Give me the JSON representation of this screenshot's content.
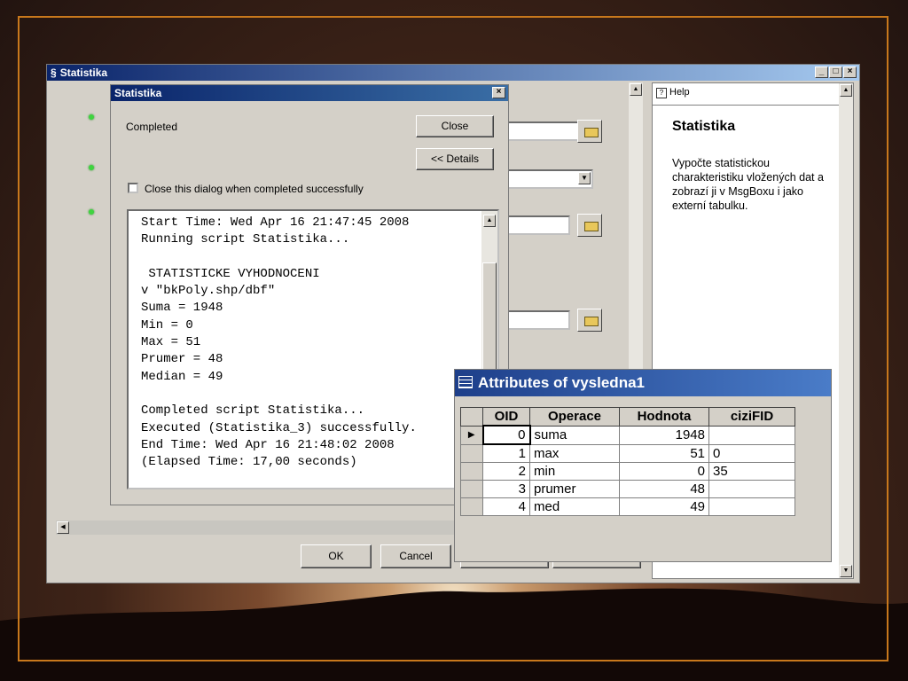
{
  "main_window": {
    "title": "Statistika"
  },
  "progress_dialog": {
    "title": "Statistika",
    "status": "Completed",
    "close_label": "Close",
    "details_label": "<< Details",
    "close_checkbox_label": "Close this dialog when completed successfully",
    "log": "Start Time: Wed Apr 16 21:47:45 2008\nRunning script Statistika...\n\n STATISTICKE VYHODNOCENI\nv \"bkPoly.shp/dbf\"\nSuma = 1948\nMin = 0\nMax = 51\nPrumer = 48\nMedian = 49\n\nCompleted script Statistika...\nExecuted (Statistika_3) successfully.\nEnd Time: Wed Apr 16 21:48:02 2008\n(Elapsed Time: 17,00 seconds)"
  },
  "buttons": {
    "ok": "OK",
    "cancel": "Cancel"
  },
  "help_panel": {
    "tab_label": "Help",
    "title": "Statistika",
    "text": "Vypočte statistickou charakteristiku vložených dat a zobrazí ji v MsgBoxu i jako externí tabulku."
  },
  "attributes_window": {
    "title": "Attributes of vysledna1",
    "columns": [
      "OID",
      "Operace",
      "Hodnota",
      "ciziFID"
    ],
    "rows": [
      [
        "0",
        "suma",
        "1948",
        ""
      ],
      [
        "1",
        "max",
        "51",
        "0"
      ],
      [
        "2",
        "min",
        "0",
        "35"
      ],
      [
        "3",
        "prumer",
        "48",
        ""
      ],
      [
        "4",
        "med",
        "49",
        ""
      ]
    ]
  },
  "colors": {
    "titlebar": "#0a246a",
    "frame": "#c8781c",
    "status_dot": "#3fd43f"
  }
}
